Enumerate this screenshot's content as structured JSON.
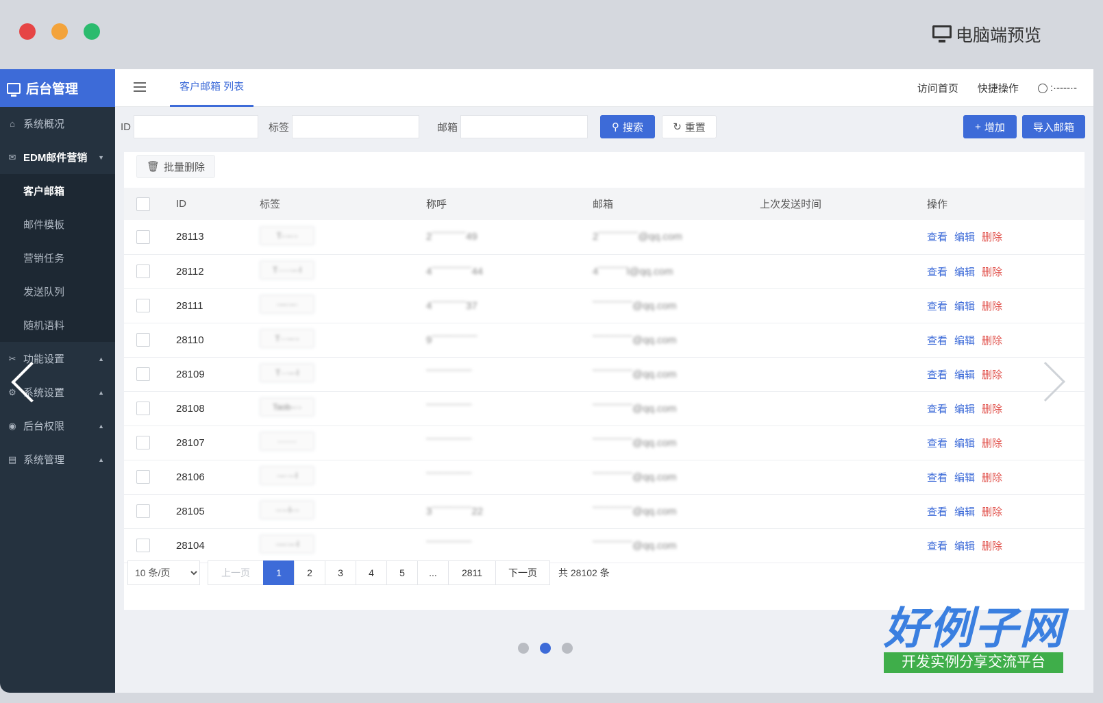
{
  "window": {
    "preview_label": "电脑端预览"
  },
  "sidebar": {
    "brand": "后台管理",
    "menu": [
      {
        "label": "系统概况",
        "icon": "home-icon"
      },
      {
        "label": "EDM邮件营销",
        "icon": "mail-icon",
        "open": true,
        "children": [
          {
            "label": "客户邮箱",
            "active": true
          },
          {
            "label": "邮件模板"
          },
          {
            "label": "营销任务"
          },
          {
            "label": "发送队列"
          },
          {
            "label": "随机语料"
          }
        ]
      },
      {
        "label": "功能设置",
        "icon": "tools-icon"
      },
      {
        "label": "系统设置",
        "icon": "gear-icon"
      },
      {
        "label": "后台权限",
        "icon": "user-circle-icon"
      },
      {
        "label": "系统管理",
        "icon": "chart-icon"
      }
    ]
  },
  "header": {
    "tab": "客户邮箱 列表",
    "links": [
      "访问首页",
      "快捷操作"
    ],
    "user": ":·----·-"
  },
  "search": {
    "id_label": "ID",
    "tag_label": "标签",
    "mail_label": "邮箱",
    "search_btn": "搜索",
    "reset_btn": "重置",
    "add_btn": "增加",
    "import_btn": "导入邮箱"
  },
  "toolbar": {
    "bulk_delete": "批量删除"
  },
  "table": {
    "headers": [
      "ID",
      "标签",
      "称呼",
      "邮箱",
      "上次发送时间",
      "操作"
    ],
    "rows": [
      {
        "id": "28113",
        "tag": "T-·--·-",
        "name": "2¯¯¯¯¯¯49",
        "mail": "2¯¯¯¯¯¯¯@qq.com"
      },
      {
        "id": "28112",
        "tag": "T·····--·l",
        "name": "4¯¯¯¯¯¯¯44",
        "mail": "4¯¯¯¯¯l@qq.com"
      },
      {
        "id": "28111",
        "tag": "·---·--·",
        "name": "4¯¯¯¯¯¯37",
        "mail": "¯¯¯¯¯¯¯@qq.com"
      },
      {
        "id": "28110",
        "tag": "T···--·-",
        "name": "9¯¯¯¯¯¯¯¯",
        "mail": "¯¯¯¯¯¯¯@qq.com"
      },
      {
        "id": "28109",
        "tag": "T···--·l",
        "name": "¯¯¯¯¯¯¯¯",
        "mail": "¯¯¯¯¯¯¯@qq.com"
      },
      {
        "id": "28108",
        "tag": "Taob--·-",
        "name": "¯¯¯¯¯¯¯¯",
        "mail": "¯¯¯¯¯¯¯@qq.com"
      },
      {
        "id": "28107",
        "tag": "·······",
        "name": "¯¯¯¯¯¯¯¯",
        "mail": "¯¯¯¯¯¯¯@qq.com"
      },
      {
        "id": "28106",
        "tag": "·--··-·l",
        "name": "¯¯¯¯¯¯¯¯",
        "mail": "¯¯¯¯¯¯¯@qq.com"
      },
      {
        "id": "28105",
        "tag": "·-·-·l-·-",
        "name": "3¯¯¯¯¯¯¯22",
        "mail": "¯¯¯¯¯¯¯@qq.com"
      },
      {
        "id": "28104",
        "tag": "·---·--·l",
        "name": "¯¯¯¯¯¯¯¯",
        "mail": "¯¯¯¯¯¯¯@qq.com"
      }
    ],
    "ops": {
      "view": "查看",
      "edit": "编辑",
      "delete": "删除"
    }
  },
  "pagination": {
    "page_size": "10 条/页",
    "prev": "上一页",
    "pages": [
      "1",
      "2",
      "3",
      "4",
      "5",
      "...",
      "2811"
    ],
    "current": "1",
    "next": "下一页",
    "total": "共 28102 条"
  },
  "carousel": {
    "count": 3,
    "active": 2
  },
  "logo": {
    "main": "好例子网",
    "sub": "开发实例分享交流平台"
  },
  "colors": {
    "primary": "#3d6bd8",
    "danger": "#e0504a",
    "sidebar": "#25323f"
  }
}
